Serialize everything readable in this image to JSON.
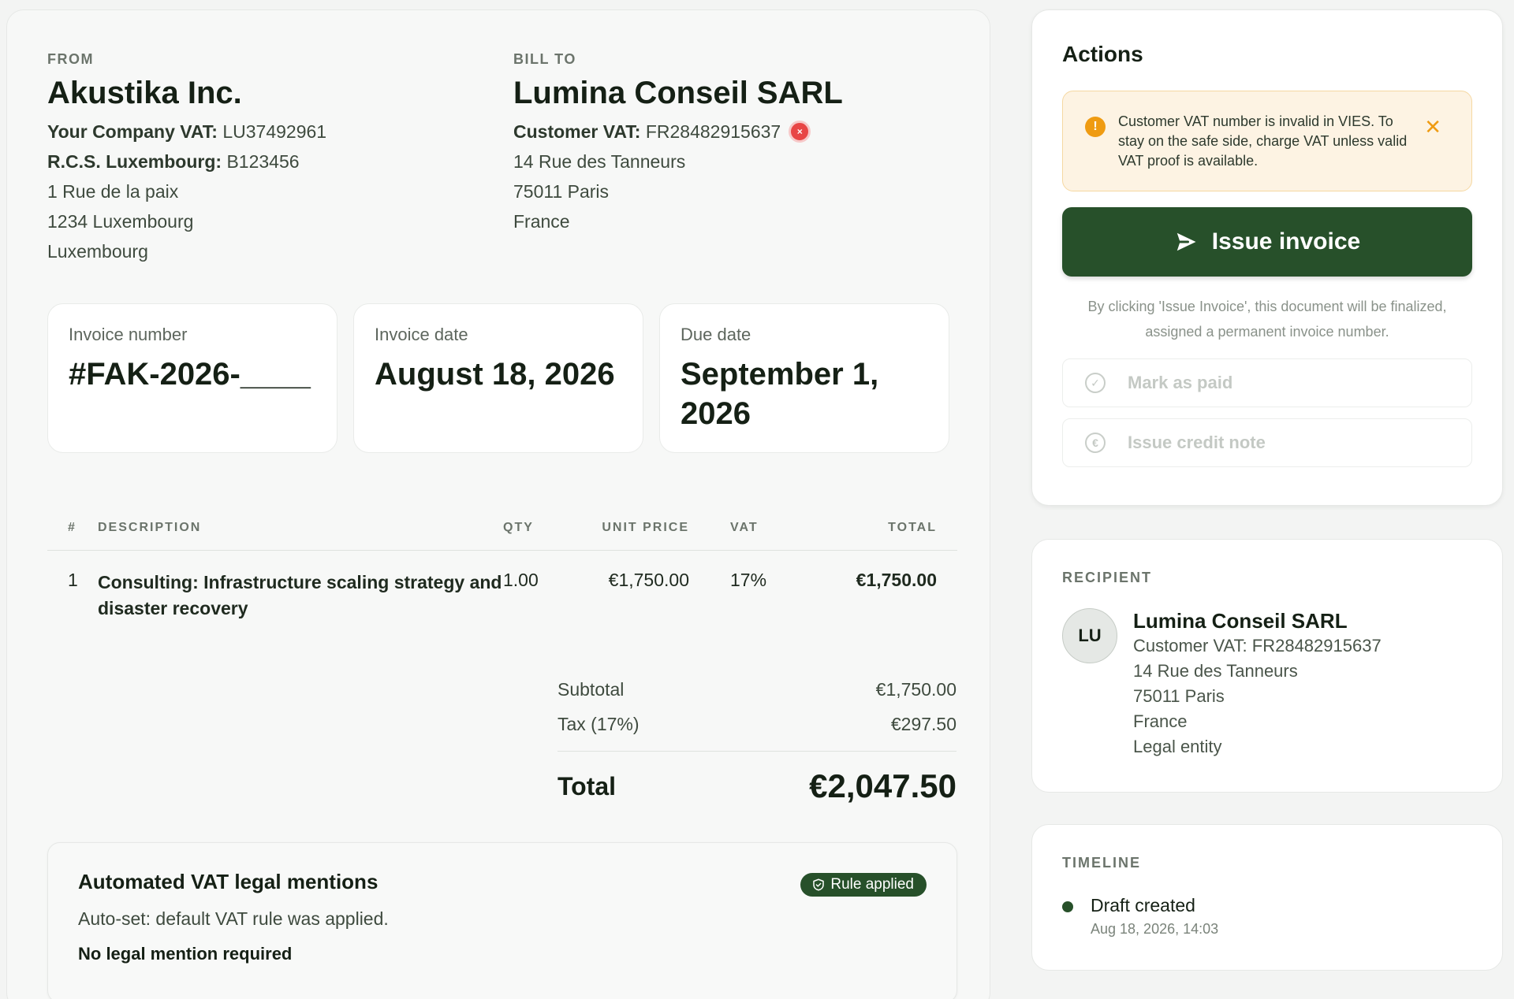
{
  "from": {
    "label": "FROM",
    "name": "Akustika Inc.",
    "vat_label": "Your Company VAT:",
    "vat_value": " LU37492961",
    "rcs_label": "R.C.S. Luxembourg:",
    "rcs_value": " B123456",
    "address1": "1 Rue de la paix",
    "address2": "1234 Luxembourg",
    "country": "Luxembourg"
  },
  "bill_to": {
    "label": "BILL TO",
    "name": "Lumina Conseil SARL",
    "vat_label": "Customer VAT:",
    "vat_value": " FR28482915637",
    "address1": "14 Rue des Tanneurs",
    "address2": "75011 Paris",
    "country": "France"
  },
  "meta": {
    "invoice_number_label": "Invoice number",
    "invoice_number": "#FAK-2026-____",
    "invoice_date_label": "Invoice date",
    "invoice_date": "August 18, 2026",
    "due_date_label": "Due date",
    "due_date": "September 1, 2026"
  },
  "items": {
    "headers": {
      "num": "#",
      "desc": "DESCRIPTION",
      "qty": "QTY",
      "unit": "UNIT PRICE",
      "vat": "VAT",
      "total": "TOTAL"
    },
    "rows": [
      {
        "num": "1",
        "desc": "Consulting: Infrastructure scaling strategy and disaster recovery",
        "qty": "1.00",
        "unit": "€1,750.00",
        "vat": "17%",
        "total": "€1,750.00"
      }
    ]
  },
  "totals": {
    "subtotal_label": "Subtotal",
    "subtotal": "€1,750.00",
    "tax_label": "Tax (17%)",
    "tax": "€297.50",
    "total_label": "Total",
    "total": "€2,047.50"
  },
  "vat_mentions": {
    "title": "Automated VAT legal mentions",
    "badge": "Rule applied",
    "subtitle": "Auto-set: default VAT rule was applied.",
    "note": "No legal mention required"
  },
  "actions": {
    "title": "Actions",
    "alert": "Customer VAT number is invalid in VIES. To stay on the safe side, charge VAT unless valid VAT proof is available.",
    "issue_button": "Issue invoice",
    "issue_hint": "By clicking 'Issue Invoice', this document will be finalized, assigned a permanent invoice number.",
    "mark_paid": "Mark as paid",
    "credit_note": "Issue credit note"
  },
  "recipient": {
    "label": "RECIPIENT",
    "initials": "LU",
    "name": "Lumina Conseil SARL",
    "vat": "Customer VAT: FR28482915637",
    "address1": "14 Rue des Tanneurs",
    "address2": "75011 Paris",
    "country": "France",
    "entity_type": "Legal entity"
  },
  "timeline": {
    "label": "TIMELINE",
    "events": [
      {
        "title": "Draft created",
        "time": "Aug 18, 2026, 14:03"
      }
    ]
  },
  "colors": {
    "brand_green": "#27502a",
    "warning_orange": "#ef9b12",
    "error_red": "#e84545"
  }
}
